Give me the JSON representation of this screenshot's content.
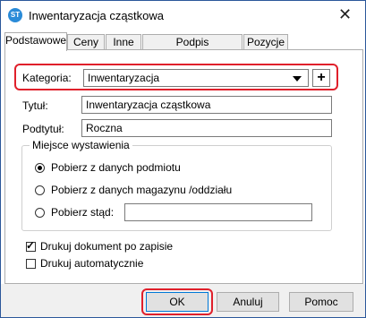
{
  "window": {
    "title": "Inwentaryzacja cząstkowa",
    "app_icon_text": "ST",
    "close_glyph": "✕"
  },
  "tabs": [
    "Podstawowe",
    "Ceny",
    "Inne",
    "Podpis elektroniczny",
    "Pozycje"
  ],
  "form": {
    "kategoria_label": "Kategoria:",
    "kategoria_value": "Inwentaryzacja",
    "plus_glyph": "+",
    "tytul_label": "Tytuł:",
    "tytul_value": "Inwentaryzacja cząstkowa",
    "podtytul_label": "Podtytuł:",
    "podtytul_value": "Roczna"
  },
  "group": {
    "title": "Miejsce wystawienia",
    "options": [
      "Pobierz z danych podmiotu",
      "Pobierz z danych magazynu /oddziału",
      "Pobierz stąd:"
    ],
    "selected": 0,
    "custom_value": ""
  },
  "checkboxes": [
    {
      "label": "Drukuj dokument po zapisie",
      "checked": true,
      "mark": "✓"
    },
    {
      "label": "Drukuj automatycznie",
      "checked": false
    }
  ],
  "buttons": {
    "ok": "OK",
    "cancel": "Anuluj",
    "help": "Pomoc"
  },
  "colors": {
    "highlight": "#e0202b",
    "icon_blue": "#2a8bd8",
    "focus_blue": "#0078d7"
  }
}
